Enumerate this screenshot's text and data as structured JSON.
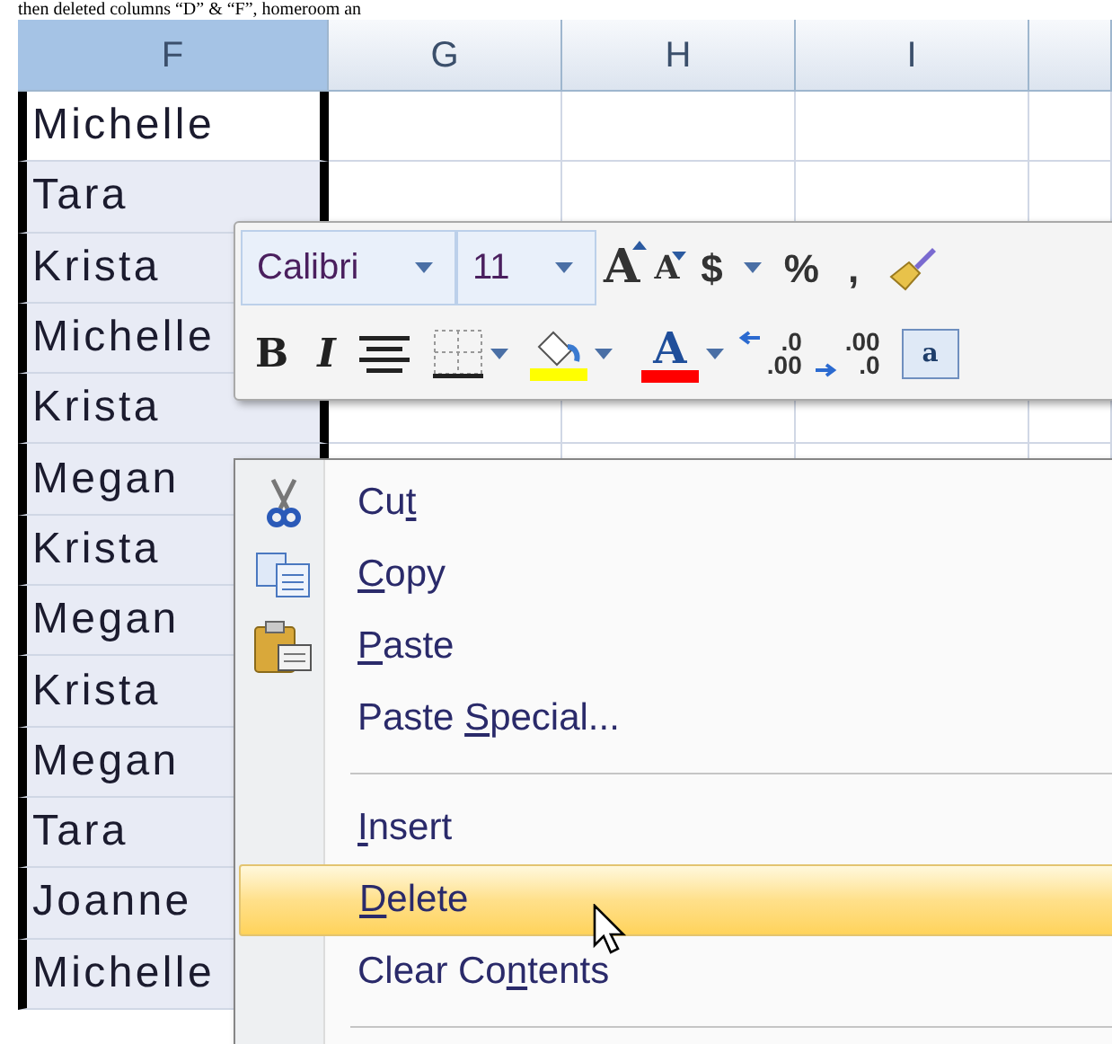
{
  "caption": "then deleted columns “D” & “F”, homeroom an",
  "columns": [
    {
      "label": "F",
      "selected": true
    },
    {
      "label": "G",
      "selected": false
    },
    {
      "label": "H",
      "selected": false
    },
    {
      "label": "I",
      "selected": false
    },
    {
      "selected": false
    }
  ],
  "rows": [
    {
      "value": "Michelle",
      "active": true
    },
    {
      "value": "Tara",
      "active": false
    },
    {
      "value": "Krista",
      "active": false
    },
    {
      "value": "Michelle",
      "active": false
    },
    {
      "value": "Krista",
      "active": false
    },
    {
      "value": "Megan",
      "active": false
    },
    {
      "value": "Krista",
      "active": false
    },
    {
      "value": "Megan",
      "active": false
    },
    {
      "value": "Krista",
      "active": false
    },
    {
      "value": "Megan",
      "active": false
    },
    {
      "value": "Tara",
      "active": false
    },
    {
      "value": "Joanne",
      "active": false
    },
    {
      "value": "Michelle",
      "active": false
    }
  ],
  "mini_toolbar": {
    "top_row": [
      {
        "kind": "font_name",
        "value": "Calibri"
      },
      {
        "kind": "font_size",
        "value": "11"
      },
      {
        "kind": "grow",
        "text": "A"
      },
      {
        "kind": "shrink",
        "text": "A"
      },
      {
        "kind": "glyph",
        "text": "$"
      },
      {
        "kind": "caret"
      },
      {
        "kind": "glyph",
        "text": "%"
      },
      {
        "kind": "glyph",
        "text": ","
      },
      {
        "kind": "brush"
      }
    ],
    "bottom_row": [
      {
        "kind": "bold",
        "text": "B"
      },
      {
        "kind": "italic",
        "text": "I"
      },
      {
        "kind": "center"
      },
      {
        "kind": "borders"
      },
      {
        "kind": "caret"
      },
      {
        "kind": "fill",
        "color": "#ffff00"
      },
      {
        "kind": "caret"
      },
      {
        "kind": "fontcolor",
        "text": "A",
        "color": "#ff0000"
      },
      {
        "kind": "caret"
      },
      {
        "kind": "decimal_more",
        "top": ".0",
        "bottom": ".00"
      },
      {
        "kind": "decimal_less",
        "top": ".00",
        "bottom": ".0"
      },
      {
        "kind": "merge",
        "text": "a"
      }
    ]
  },
  "context_menu": [
    {
      "kind": "cut",
      "before": "Cu",
      "key": "t",
      "selected": false
    },
    {
      "kind": "copy",
      "key": "C",
      "after": "opy",
      "selected": false
    },
    {
      "kind": "paste",
      "key": "P",
      "after": "aste",
      "selected": false
    },
    {
      "kind": "item",
      "before": "Paste ",
      "key": "S",
      "after": "pecial...",
      "selected": false
    },
    {
      "kind": "separator"
    },
    {
      "kind": "item",
      "key": "I",
      "after": "nsert",
      "selected": false
    },
    {
      "kind": "item",
      "key": "D",
      "after": "elete",
      "selected": true
    },
    {
      "kind": "item",
      "before": "Clear Co",
      "key": "n",
      "after": "tents",
      "selected": false
    },
    {
      "kind": "separator"
    }
  ]
}
